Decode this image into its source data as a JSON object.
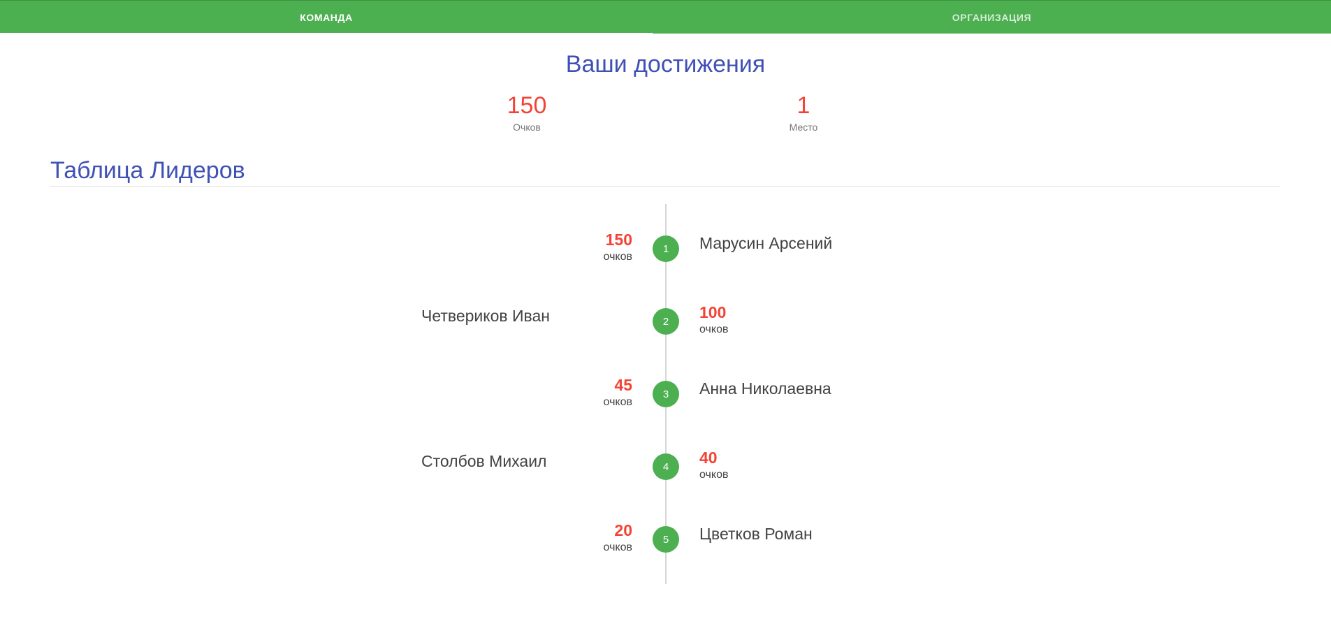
{
  "tabs": [
    {
      "label": "КОМАНДА",
      "active": true
    },
    {
      "label": "ОРГАНИЗАЦИЯ",
      "active": false
    }
  ],
  "achievements": {
    "title": "Ваши достижения",
    "points_value": "150",
    "points_label": "Очков",
    "place_value": "1",
    "place_label": "Место"
  },
  "leaderboard": {
    "title": "Таблица Лидеров",
    "entries": [
      {
        "rank": "1",
        "name": "Марусин Арсений",
        "score": "150",
        "unit": "очков"
      },
      {
        "rank": "2",
        "name": "Четвериков Иван",
        "score": "100",
        "unit": "очков"
      },
      {
        "rank": "3",
        "name": "Анна Николаевна",
        "score": "45",
        "unit": "очков"
      },
      {
        "rank": "4",
        "name": "Столбов Михаил",
        "score": "40",
        "unit": "очков"
      },
      {
        "rank": "5",
        "name": "Цветков Роман",
        "score": "20",
        "unit": "очков"
      }
    ]
  },
  "colors": {
    "accent_green": "#4caf50",
    "title_blue": "#3f51b5",
    "score_red": "#f44336"
  }
}
